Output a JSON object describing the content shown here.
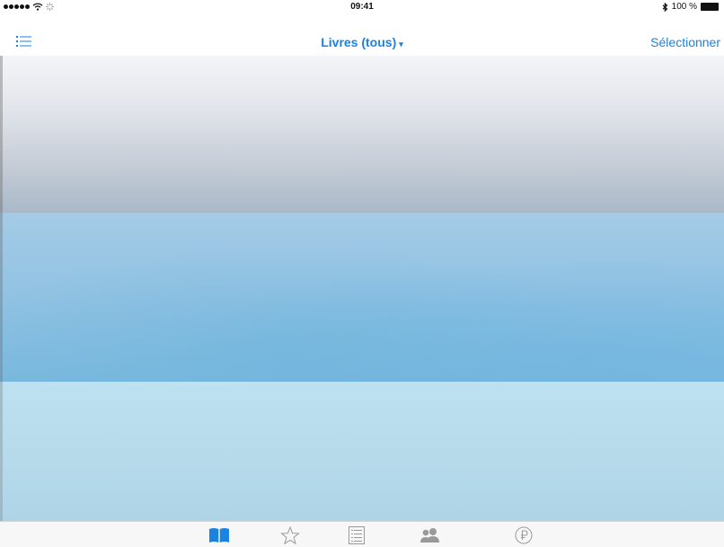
{
  "status_bar": {
    "time": "09:41",
    "battery_text": "100 %",
    "icons": [
      "signal-dots-icon",
      "wifi-icon",
      "loading-icon",
      "bluetooth-icon",
      "battery-icon"
    ]
  },
  "nav_bar": {
    "title": "Livres (tous)",
    "caret": "▾",
    "select_label": "Sélectionner",
    "left_icon": "list-menu-icon"
  },
  "tab_bar": {
    "tabs": [
      {
        "icon": "book-icon",
        "active": true
      },
      {
        "icon": "star-icon",
        "active": false
      },
      {
        "icon": "list-icon",
        "active": false
      },
      {
        "icon": "people-icon",
        "active": false
      },
      {
        "icon": "purchase-icon",
        "active": false
      }
    ]
  },
  "colors": {
    "accent": "#1a82e0",
    "inactive_icon": "#9a9a9a",
    "shelf_top": "#e1e4ea",
    "shelf_middle": "#93c3e3",
    "shelf_bottom": "#b7dbeb"
  }
}
